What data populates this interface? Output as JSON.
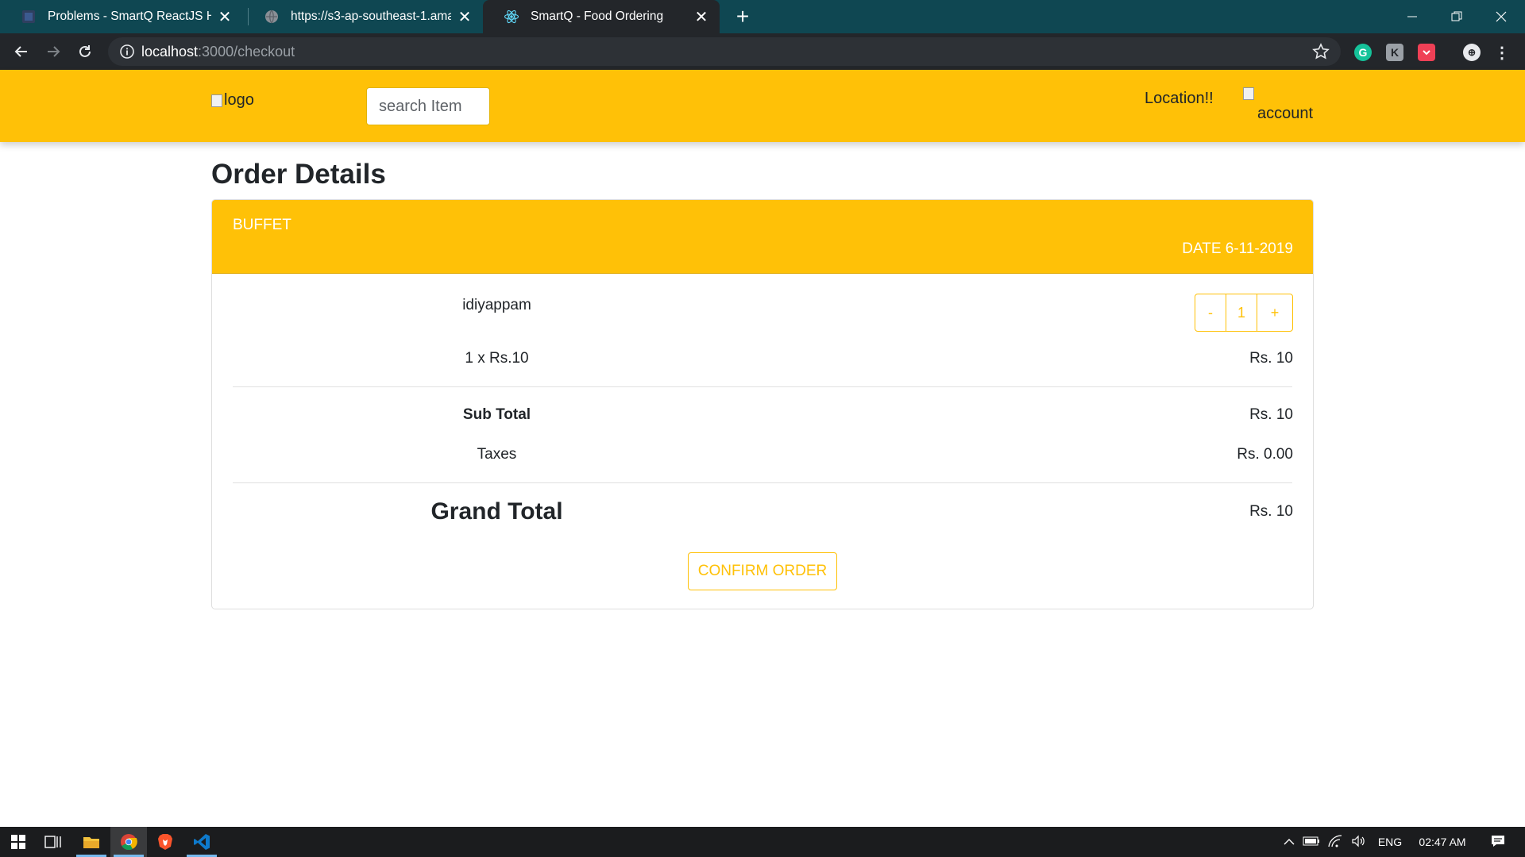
{
  "browser": {
    "tabs": [
      {
        "title": "Problems - SmartQ ReactJS Hiring",
        "favicon": "hackerearth-icon",
        "active": false
      },
      {
        "title": "https://s3-ap-southeast-1.amazonaws.com",
        "favicon": "globe-icon",
        "active": false
      },
      {
        "title": "SmartQ - Food Ordering",
        "favicon": "react-icon",
        "active": true
      }
    ],
    "address": {
      "host": "localhost",
      "path": ":3000/checkout"
    },
    "extensions": [
      "grammarly-icon",
      "extension-icon",
      "pocket-icon",
      "profile-icon"
    ]
  },
  "navbar": {
    "logo_alt": "logo",
    "search_placeholder": "search Item",
    "location": "Location!!",
    "account_alt": "account",
    "background": "#ffc107"
  },
  "page": {
    "title": "Order Details"
  },
  "order": {
    "restaurant": "BUFFET",
    "date": "DATE 6-11-2019",
    "items": [
      {
        "name": "idiyappam",
        "quantity": "1",
        "unit_line": "1 x Rs.10",
        "line_total": "Rs. 10",
        "decrement_label": "-",
        "increment_label": "+"
      }
    ],
    "summary": {
      "subtotal_label": "Sub Total",
      "subtotal_value": "Rs. 10",
      "taxes_label": "Taxes",
      "taxes_value": "Rs. 0.00",
      "grand_total_label": "Grand Total",
      "grand_total_value": "Rs. 10"
    },
    "confirm_label": "CONFIRM ORDER",
    "accent": "#ffc107"
  },
  "taskbar": {
    "apps": [
      "windows-start-icon",
      "task-view-icon",
      "file-explorer-icon",
      "chrome-icon",
      "brave-icon",
      "vscode-icon"
    ],
    "language": "ENG",
    "time": "02:47 AM"
  }
}
